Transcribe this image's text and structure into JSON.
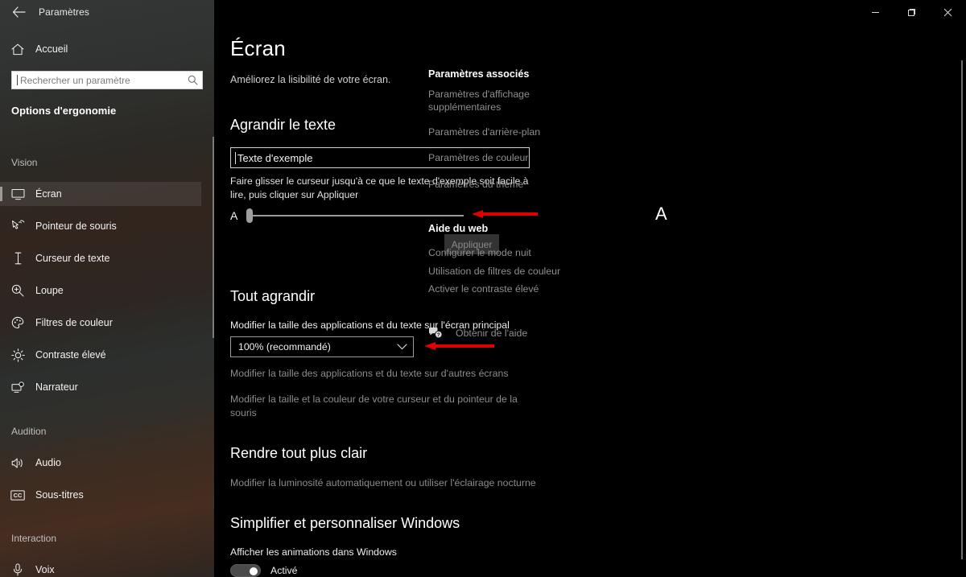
{
  "titlebar": {
    "back_icon": "back-arrow-icon",
    "title": "Paramètres",
    "minimize": "—",
    "maximize": "❐",
    "close": "✕"
  },
  "sidebar": {
    "home_label": "Accueil",
    "home_icon": "home-icon",
    "search": {
      "placeholder": "Rechercher un paramètre",
      "value": "",
      "icon": "search-icon"
    },
    "app_title": "Options d'ergonomie",
    "groups": [
      {
        "label": "Vision"
      },
      {
        "label": "Audition"
      },
      {
        "label": "Interaction"
      }
    ],
    "items": [
      {
        "label": "Écran",
        "icon": "monitor-icon",
        "selected": true
      },
      {
        "label": "Pointeur de souris",
        "icon": "mouse-pointer-icon",
        "selected": false
      },
      {
        "label": "Curseur de texte",
        "icon": "text-cursor-icon",
        "selected": false
      },
      {
        "label": "Loupe",
        "icon": "magnifier-icon",
        "selected": false
      },
      {
        "label": "Filtres de couleur",
        "icon": "palette-icon",
        "selected": false
      },
      {
        "label": "Contraste élevé",
        "icon": "brightness-icon",
        "selected": false
      },
      {
        "label": "Narrateur",
        "icon": "narrator-icon",
        "selected": false
      },
      {
        "label": "Audio",
        "icon": "speaker-icon",
        "selected": false
      },
      {
        "label": "Sous-titres",
        "icon": "closed-captions-icon",
        "selected": false
      },
      {
        "label": "Voix",
        "icon": "microphone-icon",
        "selected": false
      }
    ]
  },
  "main": {
    "page_title": "Écran",
    "page_subtitle": "Améliorez la lisibilité de votre écran.",
    "enlarge_text": {
      "heading": "Agrandir le texte",
      "sample_value": "Texte d'exemple",
      "hint": "Faire glisser le curseur jusqu'à ce que le texte d'exemple soit facile à lire, puis cliquer sur Appliquer",
      "slider_min_label": "A",
      "slider_max_label": "A",
      "slider_value": 0,
      "apply_label": "Appliquer"
    },
    "enlarge_all": {
      "heading": "Tout agrandir",
      "scale_label": "Modifier la taille des applications et du texte sur l'écran principal",
      "scale_value": "100% (recommandé)",
      "chevron_icon": "chevron-down-icon",
      "other_screens_link": "Modifier la taille des applications et du texte sur d'autres écrans",
      "cursor_link": "Modifier la taille et la couleur de votre curseur et du pointeur de la souris"
    },
    "brighter": {
      "heading": "Rendre tout plus clair",
      "link": "Modifier la luminosité automatiquement ou utiliser l'éclairage nocturne"
    },
    "simplify": {
      "heading": "Simplifier et personnaliser Windows",
      "animations_label": "Afficher les animations dans Windows",
      "animations_state": "Activé",
      "animations_on": true
    }
  },
  "rail": {
    "related_heading": "Paramètres associés",
    "related_links": [
      "Paramètres d'affichage supplémentaires",
      "Paramètres d'arrière-plan",
      "Paramètres de couleur",
      "Paramètres du thème"
    ],
    "web_heading": "Aide du web",
    "web_links": [
      "Configurer le mode nuit",
      "Utilisation de filtres de couleur",
      "Activer le contraste élevé"
    ],
    "help_label": "Obtenir de l'aide",
    "help_icon": "help-bubble-icon"
  },
  "annotations": {
    "accent_color": "#e00000",
    "arrow_slider": "arrow-pointing-to-text-size-slider",
    "arrow_combo": "arrow-pointing-to-scale-dropdown"
  }
}
